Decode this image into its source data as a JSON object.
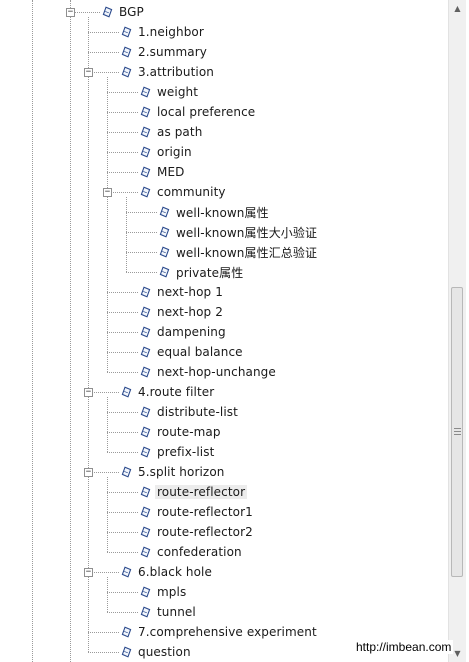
{
  "tree": {
    "nodes": [
      {
        "label": "BGP",
        "depth": 0,
        "expander": "−"
      },
      {
        "label": "1.neighbor",
        "depth": 1
      },
      {
        "label": "2.summary",
        "depth": 1
      },
      {
        "label": "3.attribution",
        "depth": 1,
        "expander": "−"
      },
      {
        "label": "weight",
        "depth": 2
      },
      {
        "label": "local preference",
        "depth": 2
      },
      {
        "label": "as path",
        "depth": 2
      },
      {
        "label": "origin",
        "depth": 2
      },
      {
        "label": "MED",
        "depth": 2
      },
      {
        "label": "community",
        "depth": 2,
        "expander": "−"
      },
      {
        "label": "well-known属性",
        "depth": 3
      },
      {
        "label": "well-known属性大小验证",
        "depth": 3
      },
      {
        "label": "well-known属性汇总验证",
        "depth": 3
      },
      {
        "label": "private属性",
        "depth": 3
      },
      {
        "label": "next-hop 1",
        "depth": 2
      },
      {
        "label": "next-hop 2",
        "depth": 2
      },
      {
        "label": "dampening",
        "depth": 2
      },
      {
        "label": "equal balance",
        "depth": 2
      },
      {
        "label": "next-hop-unchange",
        "depth": 2
      },
      {
        "label": "4.route filter",
        "depth": 1,
        "expander": "−"
      },
      {
        "label": "distribute-list",
        "depth": 2
      },
      {
        "label": "route-map",
        "depth": 2
      },
      {
        "label": "prefix-list",
        "depth": 2
      },
      {
        "label": "5.split horizon",
        "depth": 1,
        "expander": "−"
      },
      {
        "label": "route-reflector",
        "depth": 2,
        "selected": true
      },
      {
        "label": "route-reflector1",
        "depth": 2
      },
      {
        "label": "route-reflector2",
        "depth": 2
      },
      {
        "label": "confederation",
        "depth": 2
      },
      {
        "label": "6.black hole",
        "depth": 1,
        "expander": "−"
      },
      {
        "label": "mpls",
        "depth": 2
      },
      {
        "label": "tunnel",
        "depth": 2
      },
      {
        "label": "7.comprehensive experiment",
        "depth": 1
      },
      {
        "label": "question",
        "depth": 1
      }
    ]
  },
  "icons": {
    "node": "leaf-node-icon",
    "expander": "collapse-toggle"
  },
  "scrollbar": {
    "up": "▲",
    "down": "▼",
    "position": 0.72
  },
  "watermark": {
    "text": "http://imbean.com"
  },
  "colors": {
    "icon_stroke": "#2b4a8c",
    "icon_fill": "#f2f6fc",
    "line": "#9a9a9a",
    "selected_bg": "#ececec"
  }
}
